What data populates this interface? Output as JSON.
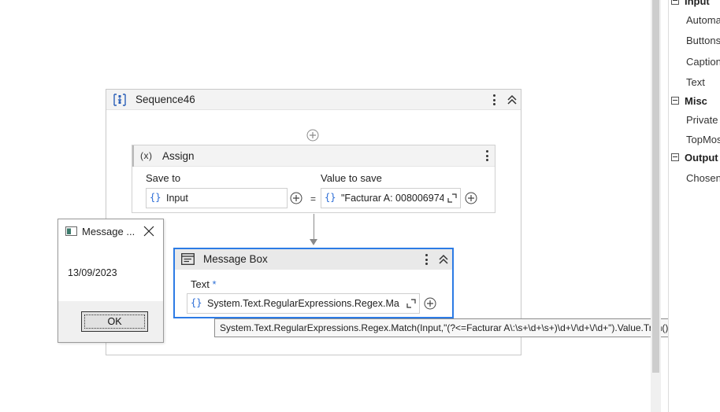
{
  "sequence": {
    "title": "Sequence46"
  },
  "assign": {
    "title": "Assign",
    "icon_text": "(x)",
    "save_to_label": "Save to",
    "value_label": "Value to save",
    "save_to_value": "Input",
    "value_to_save": "\"Facturar A: 008006974",
    "equals": "="
  },
  "message_box_activity": {
    "title": "Message Box",
    "text_label": "Text",
    "required_mark": "*",
    "text_value": "System.Text.RegularExpressions.Regex.Match"
  },
  "tooltip": {
    "text": "System.Text.RegularExpressions.Regex.Match(Input,\"(?<=Facturar A\\:\\s+\\d+\\s+)\\d+\\/\\d+\\/\\d+\").Value.Trim()"
  },
  "brace_symbol": "{}",
  "runtime_dialog": {
    "title": "Message ...",
    "body": "13/09/2023",
    "ok_label": "OK"
  },
  "properties_panel": {
    "categories": [
      {
        "label": "Input",
        "items": [
          "Automa",
          "Buttons",
          "Caption",
          "Text"
        ]
      },
      {
        "label": "Misc",
        "items": [
          "Private",
          "TopMos"
        ]
      },
      {
        "label": "Output",
        "items": [
          "Chosen"
        ]
      }
    ]
  },
  "colors": {
    "accent_blue": "#2c7be5",
    "brace_blue": "#2a6cd6",
    "header_gray": "#f3f3f3"
  }
}
